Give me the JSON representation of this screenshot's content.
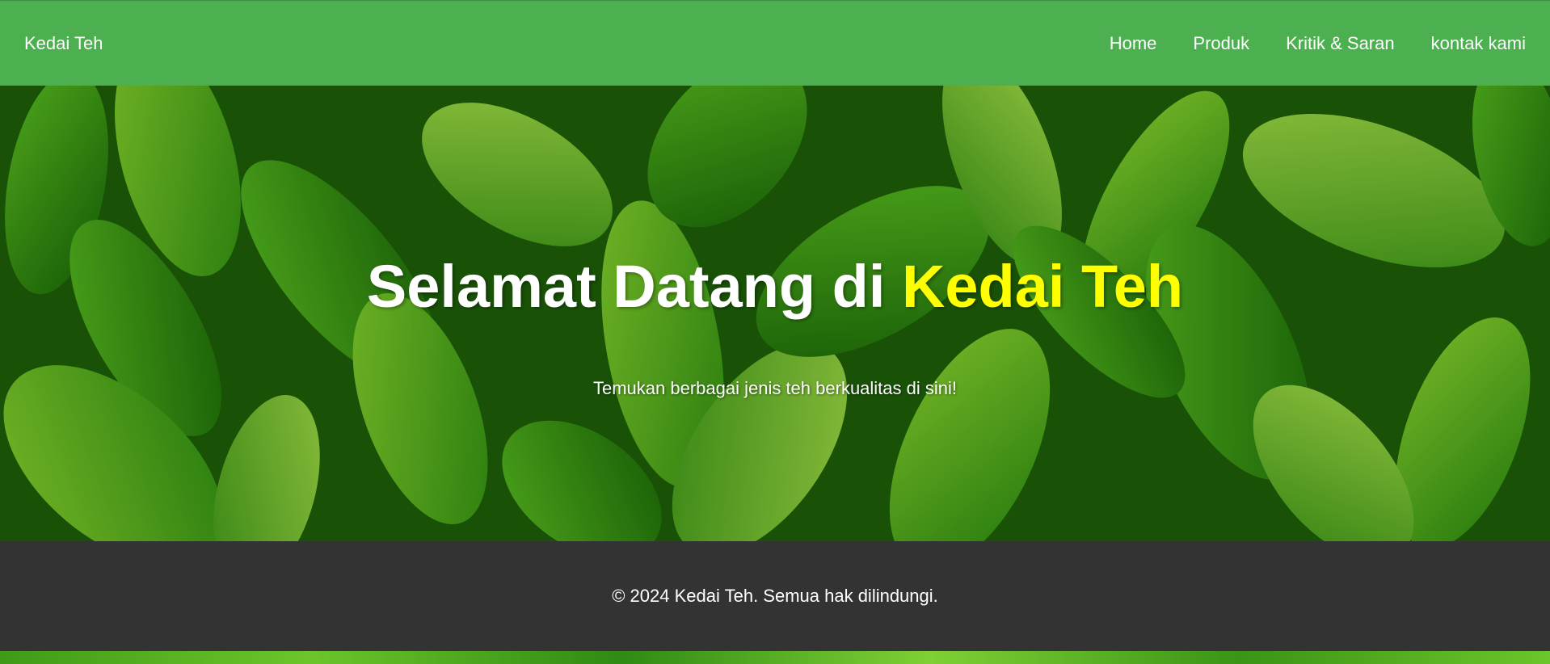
{
  "navbar": {
    "brand": "Kedai Teh",
    "links": [
      {
        "label": "Home"
      },
      {
        "label": "Produk"
      },
      {
        "label": "Kritik & Saran"
      },
      {
        "label": "kontak kami"
      }
    ]
  },
  "hero": {
    "title_prefix": "Selamat Datang di ",
    "title_accent": "Kedai Teh",
    "subtitle": "Temukan berbagai jenis teh berkualitas di sini!",
    "background": "tea-leaves-image"
  },
  "footer": {
    "copyright": "© 2024 Kedai Teh. Semua hak dilindungi."
  },
  "colors": {
    "navbar": "#4caf50",
    "footer": "#333333",
    "accent": "#ffff00",
    "text": "#ffffff"
  }
}
